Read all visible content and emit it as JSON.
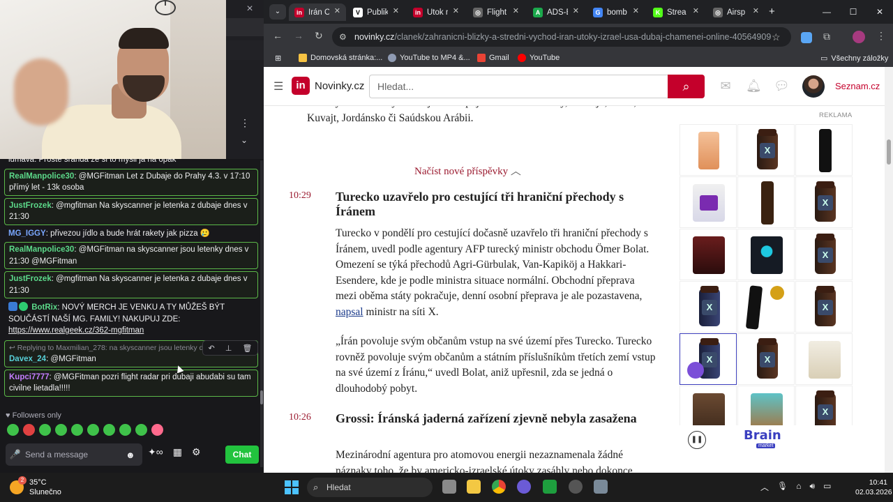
{
  "chat": {
    "close_icon": "×",
    "followers_only": "Followers only",
    "input_placeholder": "Send a message",
    "send_label": "Chat",
    "cut_off_message": "lumava: Proste sranda ze si to mysli ja na opak",
    "messages": [
      {
        "user": "RealManpolice30",
        "text": ": @MGFitman Let z Dubaje do Prahy 4.3. v 17:10 přímý let - 13k osoba",
        "highlight": true,
        "color": "green"
      },
      {
        "user": "JustFrozek",
        "text": ": @mgfitman Na skyscanner je letenka z dubaje dnes v 21:30",
        "highlight": true,
        "color": "green"
      },
      {
        "user": "MG_IGGY",
        "text": ": přivezou jídlo a bude hrát rakety jak pizza 🥲",
        "highlight": false,
        "color": "blue"
      },
      {
        "user": "RealManpolice30",
        "text": ": @MGFitman na skyscanner jsou letenky dnes v 21:30 @MGFitman",
        "highlight": true,
        "color": "green"
      },
      {
        "user": "JustFrozek",
        "text": ": @mgfitman Na skyscanner je letenka z dubaje dnes v 21:30",
        "highlight": true,
        "color": "green"
      }
    ],
    "bot_message": {
      "user": "BotRix",
      "text": ": NOVÝ MERCH JE VENKU A TY MŮŽEŠ BÝT SOUČÁSTÍ NAŠÍ MG. FAMILY! NAKUPUJ ZDE:",
      "link": "https://www.realgeek.cz/362-mgfitman"
    },
    "reply_message": {
      "reply_to": "Replying to Maxmilian_278: na skyscanner jsou letenky d",
      "user": "Davex_24",
      "text": ": @MGFitman"
    },
    "last_message": {
      "user": "Kupci7777",
      "text": ": @MGFitman pozri flight radar pri dubaji abudabi su tam civilne lietadla!!!!!"
    }
  },
  "browser": {
    "tabs": [
      {
        "title": "Írán O",
        "color": "#c4002b",
        "letter": "in",
        "active": true
      },
      {
        "title": "Publik",
        "color": "#ffffff",
        "letter": "V",
        "active": false
      },
      {
        "title": "Útok n",
        "color": "#c4002b",
        "letter": "in",
        "active": false
      },
      {
        "title": "Flight",
        "color": "#666666",
        "letter": "◎",
        "active": false
      },
      {
        "title": "ADS-B",
        "color": "#1ba94c",
        "letter": "A",
        "active": false
      },
      {
        "title": "bomb",
        "color": "#4285f4",
        "letter": "G",
        "active": false
      },
      {
        "title": "Strea",
        "color": "#53fc18",
        "letter": "K",
        "active": false
      },
      {
        "title": "Airsp",
        "color": "#666666",
        "letter": "◎",
        "active": false
      }
    ],
    "url_host": "novinky.cz",
    "url_path": "/clanek/zahranicni-blizky-a-stredni-vychod-iran-utoky-izrael-usa-dubaj-chamenei-online-40564909",
    "bookmarks": [
      "Domovská stránka:...",
      "YouTube to MP4 &...",
      "Gmail",
      "YouTube"
    ],
    "all_bookmarks": "Všechny záložky"
  },
  "site": {
    "logo_letter": "in",
    "logo_text": "Novinky.cz",
    "search_placeholder": "Hledat...",
    "seznam": "Seznam.cz",
    "intro_text": "Desítky úderů mířily mimo jiné na Spojené arabské emiráty, Bahrajn, Katar, Kuvajt, Jordánsko či Saúdskou Arábii.",
    "load_new": "Načíst nové příspěvky",
    "posts": [
      {
        "time": "10:29",
        "title": "Turecko uzavřelo pro cestující tři hraniční přechody s Íránem",
        "body1": "Turecko v pondělí pro cestující dočasně uzavřelo tři hraniční přechody s Íránem, uvedl podle agentury AFP turecký ministr obchodu Ömer Bolat. Omezení se týká přechodů Agri-Gürbulak, Van-Kapiköj a Hakkari-Esendere, kde je podle ministra situace normální. Obchodní přeprava mezi oběma státy pokračuje, denní osobní přeprava je ale pozastavena,",
        "link": "napsal",
        "body1_end": " ministr na síti X.",
        "body2": "„Írán povoluje svým občanům vstup na své území přes Turecko. Turecko rovněž povoluje svým občanům a státním příslušníkům třetích zemí vstup na své území z Íránu,“ uvedl Bolat, aniž upřesnil, zda se jedná o dlouhodobý pobyt."
      },
      {
        "time": "10:26",
        "title": "Grossi: Íránská jaderná zařízení zjevně nebyla zasažena",
        "body1": "Mezinárodní agentura pro atomovou energii nezaznamenala žádné náznaky toho, že by americko-izraelské útoky zasáhly nebo dokonce"
      }
    ]
  },
  "ad": {
    "label": "REKLAMA",
    "brand": "Brain",
    "brand_sub": "market"
  },
  "taskbar": {
    "temp": "35°C",
    "weather": "Slunečno",
    "notif": "2",
    "search": "Hledat",
    "time": "10:41",
    "date": "02.03.2026"
  }
}
